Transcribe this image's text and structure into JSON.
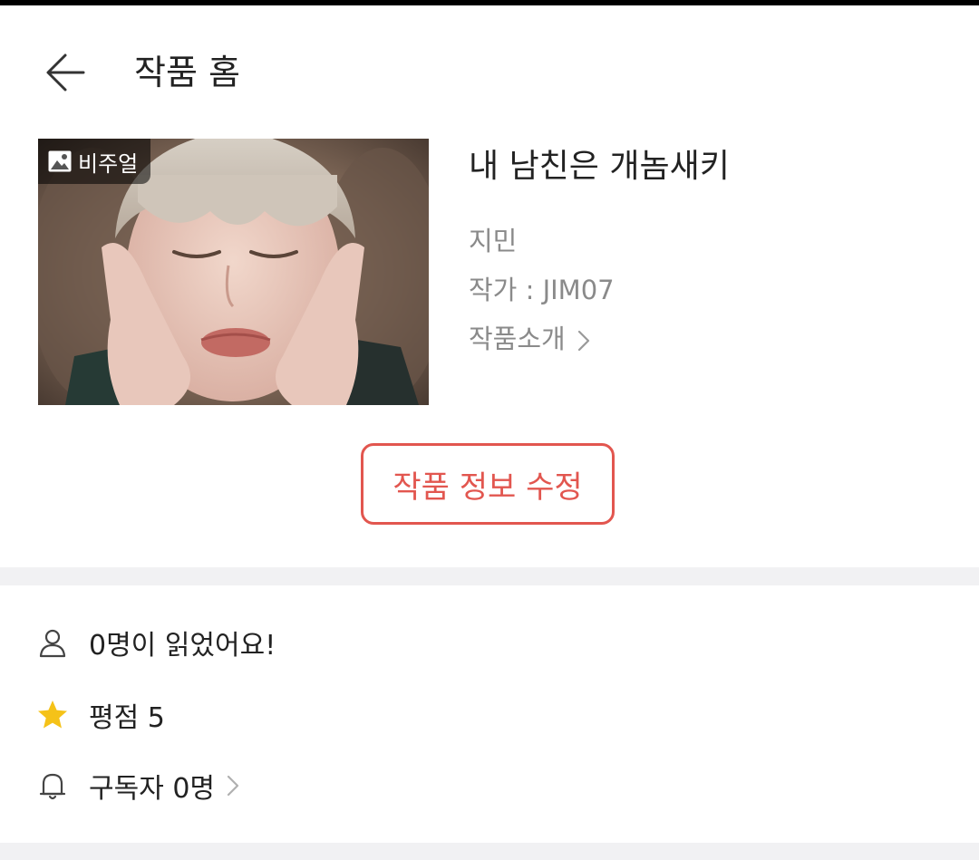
{
  "header": {
    "title": "작품 홈",
    "back_icon": "arrow-left-icon"
  },
  "work": {
    "cover_badge_label": "비주얼",
    "cover_badge_icon": "image-icon",
    "title": "내 남친은 개놈새키",
    "character": "지민",
    "author_line": "작가 : JIM07",
    "intro_link": "작품소개",
    "intro_chevron_icon": "chevron-right-icon"
  },
  "edit_button": {
    "label": "작품 정보 수정"
  },
  "stats": {
    "readers": {
      "icon": "person-icon",
      "text": "0명이 읽었어요!"
    },
    "rating": {
      "icon": "star-icon",
      "text": "평점 5"
    },
    "subscribers": {
      "icon": "bell-icon",
      "text": "구독자 0명",
      "chevron_icon": "chevron-right-icon"
    }
  },
  "colors": {
    "accent": "#e2564f",
    "muted_text": "#8a8a8a",
    "divider_band": "#f1f1f3",
    "star": "#f5c218"
  }
}
